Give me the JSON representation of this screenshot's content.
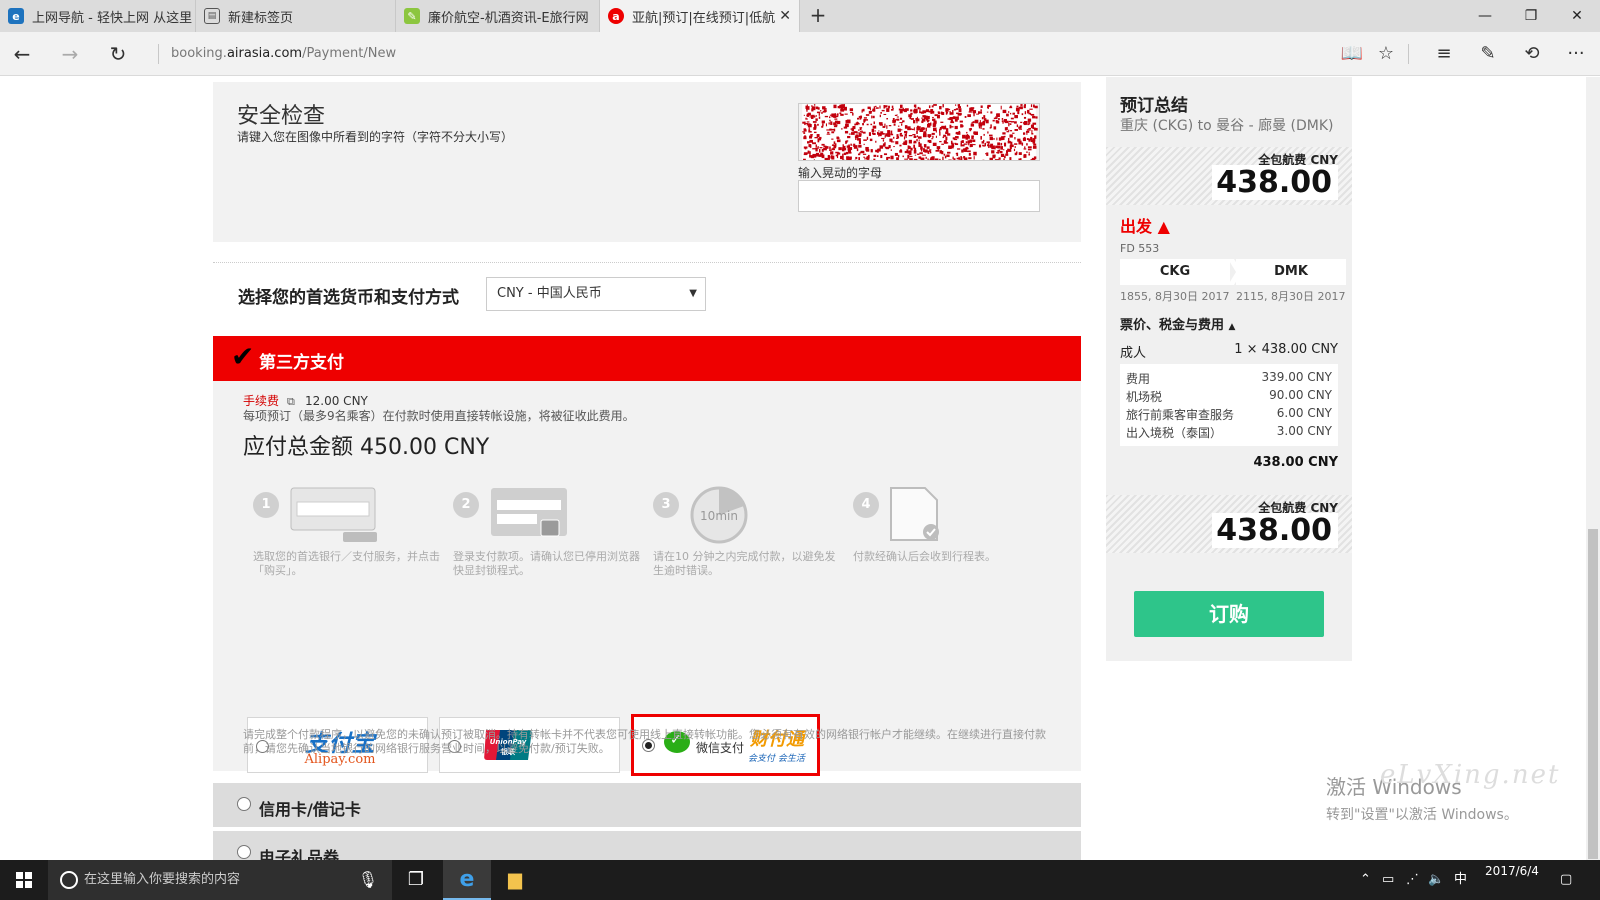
{
  "browser": {
    "tabs": [
      {
        "title": "上网导航 - 轻快上网 从这里",
        "icon": "ie-icon"
      },
      {
        "title": "新建标签页",
        "icon": "newtab-page-icon"
      },
      {
        "title": "廉价航空-机酒资讯-E旅行网",
        "icon": "leaf-icon"
      },
      {
        "title": "亚航|预订|在线预订|低航",
        "icon": "airasia-icon"
      }
    ],
    "url_prefix": "booking.",
    "url_domain": "airasia.com",
    "url_path": "/Payment/New"
  },
  "security": {
    "title": "安全检查",
    "description": "请键入您在图像中所看到的字符（字符不分大小写）",
    "captcha_label": "输入晃动的字母",
    "captcha_value": ""
  },
  "payment": {
    "currency_label": "选择您的首选货币和支付方式",
    "currency_value": "CNY - 中国人民币",
    "third_party_title": "第三方支付",
    "fee_label": "手续费",
    "fee_value": "12.00 CNY",
    "fee_desc": "每项预订（最多9名乘客）在付款时使用直接转帐设施，将被征收此费用。",
    "total_due": "应付总金额 450.00 CNY",
    "steps": [
      {
        "num": "1",
        "text": "选取您的首选银行／支付服务，并点击「购买」。"
      },
      {
        "num": "2",
        "text": "登录支付款项。请确认您已停用浏览器快显封锁程式。"
      },
      {
        "num": "3",
        "text": "请在10 分钟之内完成付款，以避免发生逾时错误。"
      },
      {
        "num": "4",
        "text": "付款经确认后会收到行程表。"
      }
    ],
    "step3_badge": "10min",
    "methods": {
      "alipay_cn": "支付宝",
      "alipay_en": "Alipay.com",
      "unionpay_en": "UnionPay",
      "unionpay_cn": "银联",
      "wechat_label": "微信支付",
      "tenpay_label": "财付通",
      "tenpay_sub": "会支付 会生活",
      "selected": "wechat"
    },
    "note": "请完成整个付款程序，以避免您的未确认预订被取消。持有转帐卡并不代表您可使用线上直接转帐功能。您必须有有效的网络银行帐户才能继续。在继续进行直接付款前，请您先确认当地银行的网络银行服务营业时间，以避免付款/预订失败。",
    "card_option": "信用卡/借记卡",
    "gift_option": "电子礼品券"
  },
  "summary": {
    "title": "预订总结",
    "route": "重庆 (CKG) to 曼谷 - 廊曼 (DMK)",
    "price_caption": "全包航费 CNY",
    "price": "438.00",
    "depart_label": "出发",
    "flight_no": "FD 553",
    "from_code": "CKG",
    "to_code": "DMK",
    "from_time": "1855, 8月30日 2017",
    "to_time": "2115, 8月30日 2017",
    "fees_heading": "票价、税金与费用",
    "adult_label": "成人",
    "adult_value": "1 × 438.00 CNY",
    "fees": [
      {
        "label": "费用",
        "value": "339.00 CNY"
      },
      {
        "label": "机场税",
        "value": "90.00 CNY"
      },
      {
        "label": "旅行前乘客审查服务",
        "value": "6.00 CNY"
      },
      {
        "label": "出入境税（泰国）",
        "value": "3.00 CNY"
      }
    ],
    "fees_total": "438.00 CNY",
    "price_caption_2": "全包航费 CNY",
    "price_2": "438.00",
    "buy_label": "订购"
  },
  "os": {
    "activate_line1": "激活 Windows",
    "activate_line2": "转到\"设置\"以激活 Windows。",
    "search_placeholder": "在这里输入你要搜索的内容",
    "ime": "中",
    "date": "2017/6/4",
    "watermark": "eLvXing.net"
  },
  "colors": {
    "airasia_red": "#ee0000",
    "buy_green": "#2ec58a"
  }
}
